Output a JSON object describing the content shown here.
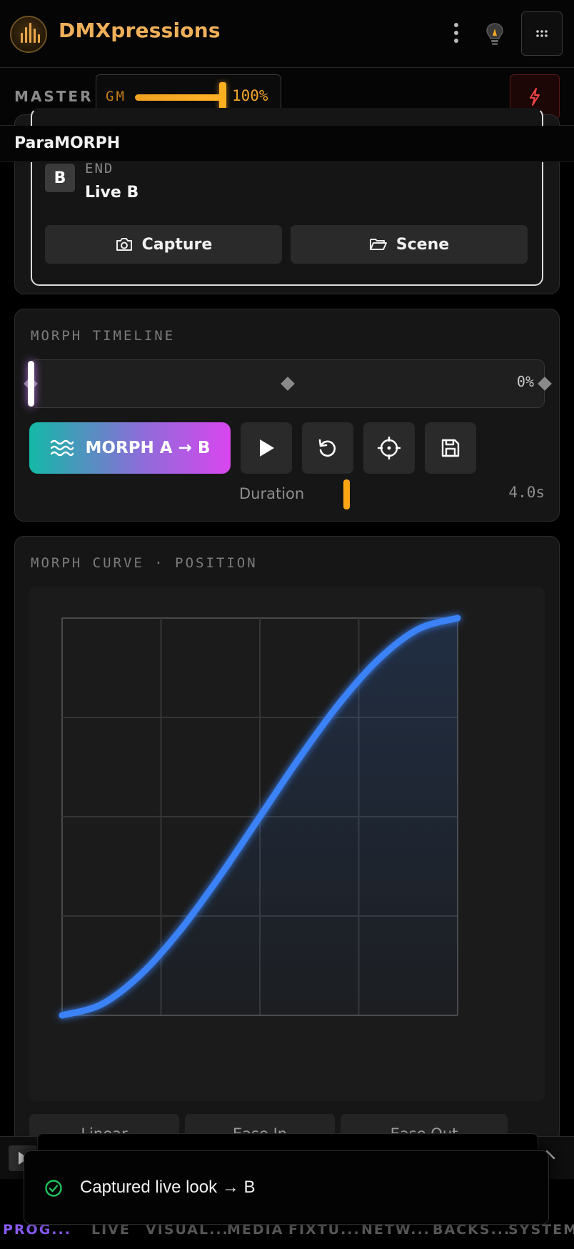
{
  "app": {
    "title": "DMXpressions"
  },
  "master": {
    "label": "MASTER",
    "gm_label": "GM",
    "gm_value": "100%",
    "gm_level": 1.0
  },
  "section": {
    "title": "ParaMORPH"
  },
  "end": {
    "badge": "B",
    "label": "END",
    "value": "Live B",
    "capture_label": "Capture",
    "scene_label": "Scene"
  },
  "timeline": {
    "label": "MORPH TIMELINE",
    "percent": "0%",
    "position": 0,
    "morph_label": "MORPH A → B",
    "duration_label": "Duration",
    "duration_value": "4.0s"
  },
  "curve": {
    "label": "MORPH CURVE · POSITION",
    "line_color": "#3b82f6",
    "presets": [
      "Linear",
      "Ease In",
      "Ease Out"
    ]
  },
  "chart_data": {
    "type": "line",
    "x": [
      0,
      0.1,
      0.2,
      0.3,
      0.4,
      0.5,
      0.6,
      0.7,
      0.8,
      0.9,
      1.0
    ],
    "series": [
      {
        "values": [
          0,
          0.028,
          0.104,
          0.216,
          0.352,
          0.5,
          0.648,
          0.784,
          0.896,
          0.972,
          1.0
        ]
      }
    ],
    "xlim": [
      0,
      1
    ],
    "ylim": [
      0,
      1
    ],
    "grid": true,
    "title": "",
    "xlabel": "",
    "ylabel": ""
  },
  "nav": {
    "items": [
      "PROG...",
      "LIVE",
      "VISUAL...",
      "MEDIA",
      "FIXTU...",
      "NETW...",
      "BACKS...",
      "SYSTEM"
    ],
    "active": 0
  },
  "toast": {
    "message": "Captured live look → B"
  },
  "colors": {
    "accent": "#f0b05a",
    "active_nav": "#8b5cf6",
    "success": "#22c55e",
    "danger": "#ef4444"
  }
}
